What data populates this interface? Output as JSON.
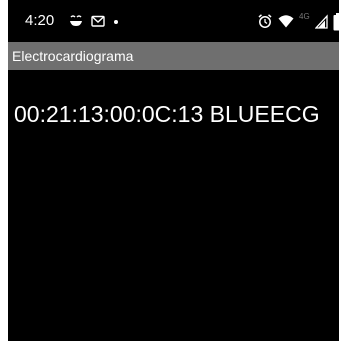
{
  "status_bar": {
    "time": "4:20",
    "left_icons": [
      "weather-icon",
      "gmail-icon",
      "notification-dot-icon"
    ],
    "right_icons": [
      "alarm-icon",
      "wifi-icon",
      "cellular-signal-icon",
      "battery-icon"
    ],
    "network_label": "4G"
  },
  "action_bar": {
    "title": "Electrocardiograma"
  },
  "device_list": {
    "items": [
      {
        "label": "00:21:13:00:0C:13 BLUEECG"
      }
    ]
  },
  "colors": {
    "background": "#000000",
    "action_bar": "#6f6f6f",
    "text": "#ffffff"
  }
}
